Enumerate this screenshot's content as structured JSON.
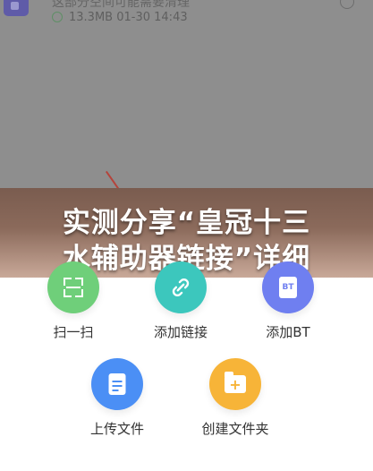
{
  "file": {
    "name": "这部分空间可能需要清理",
    "size": "13.3MB",
    "date": "01-30 14:43",
    "icon": "video-file-icon"
  },
  "banner": {
    "line1": "实测分享“皇冠十三",
    "line2": "水辅助器链接”详细"
  },
  "actions": [
    {
      "label": "扫一扫",
      "icon": "scan-icon",
      "color": "#6fcf7a"
    },
    {
      "label": "添加链接",
      "icon": "link-icon",
      "color": "#3cc7bd"
    },
    {
      "label": "添加BT",
      "icon": "bt-icon",
      "color": "#6f7ff0",
      "glyph": "BT"
    },
    {
      "label": "上传文件",
      "icon": "document-icon",
      "color": "#4b8ff5"
    },
    {
      "label": "创建文件夹",
      "icon": "folder-plus-icon",
      "color": "#f7b438",
      "glyph": "+"
    }
  ]
}
